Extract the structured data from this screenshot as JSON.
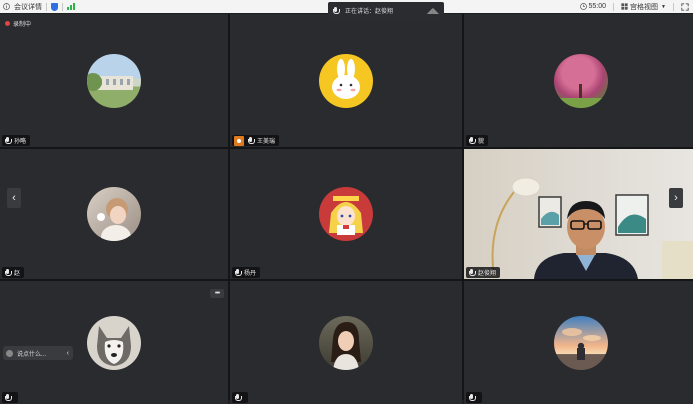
{
  "topbar": {
    "meeting_details": "会议详情",
    "timer": "55:00",
    "view_mode": "宫格视图"
  },
  "speaking": {
    "label": "正在讲话：赵俊翔"
  },
  "recording": {
    "label": "录制中"
  },
  "participants": [
    {
      "name": "孙略",
      "avatar": "building-photo-avatar"
    },
    {
      "name": "王美瑞",
      "avatar": "bunny-cartoon-avatar"
    },
    {
      "name": "貌",
      "avatar": "cherry-blossom-avatar"
    },
    {
      "name": "赵",
      "avatar": "child-photo-avatar"
    },
    {
      "name": "杨丹",
      "avatar": "anime-girl-avatar"
    },
    {
      "name": "赵俊翔",
      "avatar": "video-feed"
    },
    {
      "name": "",
      "avatar": "husky-dog-avatar"
    },
    {
      "name": "",
      "avatar": "woman-portrait-avatar"
    },
    {
      "name": "",
      "avatar": "sunset-sky-avatar"
    }
  ],
  "chat": {
    "placeholder": "说点什么..."
  },
  "colors": {
    "active_border": "#35c35b",
    "recording": "#e04444",
    "shield": "#2f6fe0"
  }
}
